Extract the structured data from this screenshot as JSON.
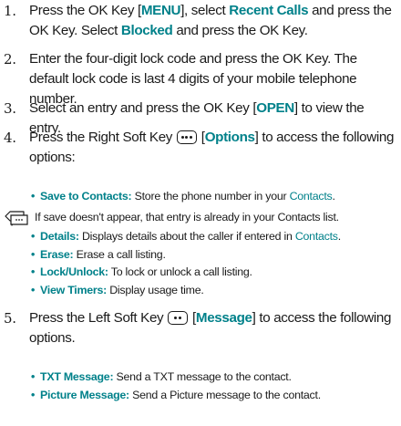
{
  "steps": [
    {
      "num": "1.",
      "parts": [
        {
          "t": "Press the OK Key ["
        },
        {
          "t": "MENU",
          "hl": true
        },
        {
          "t": "], select "
        },
        {
          "t": "Recent Calls",
          "hl": true
        },
        {
          "t": " and press the OK Key. Select "
        },
        {
          "t": "Blocked",
          "hl": true
        },
        {
          "t": " and press the OK Key."
        }
      ]
    },
    {
      "num": "2.",
      "parts": [
        {
          "t": "Enter the four-digit lock code and press the OK Key. The default lock code is last 4 digits of your mobile telephone number."
        }
      ]
    },
    {
      "num": "3.",
      "parts": [
        {
          "t": "Select an entry and press the OK Key ["
        },
        {
          "t": "OPEN",
          "hl": true
        },
        {
          "t": "] to view the entry."
        }
      ]
    },
    {
      "num": "4.",
      "parts": [
        {
          "t": "Press the Right Soft Key "
        },
        {
          "icon": "right-soft-key-icon"
        },
        {
          "t": " ["
        },
        {
          "t": "Options",
          "hl": true
        },
        {
          "t": "] to access the following options:"
        }
      ],
      "bullets": [
        {
          "label": "Save to Contacts:",
          "text": " Store the phone number in your ",
          "link": "Contacts",
          "tail": "."
        }
      ],
      "note": "If save doesn't appear, that entry is already in your Contacts list.",
      "bullets2": [
        {
          "label": "Details:",
          "text": " Displays details about the caller if entered in ",
          "link": "Contacts",
          "tail": "."
        },
        {
          "label": "Erase:",
          "text": " Erase a call listing."
        },
        {
          "label": "Lock/Unlock:",
          "text": " To lock or unlock a call listing."
        },
        {
          "label": "View Timers:",
          "text": " Display usage time."
        }
      ]
    },
    {
      "num": "5.",
      "parts": [
        {
          "t": "Press the Left Soft Key "
        },
        {
          "icon": "left-soft-key-icon"
        },
        {
          "t": " ["
        },
        {
          "t": "Message",
          "hl": true
        },
        {
          "t": "] to access the following options."
        }
      ],
      "bullets": [
        {
          "label": "TXT Message:",
          "text": " Send a TXT message to the contact."
        },
        {
          "label": "Picture Message:",
          "text": " Send a Picture message to the contact."
        }
      ]
    }
  ],
  "colors": {
    "accent": "#00818a",
    "text": "#1a1a1a"
  }
}
